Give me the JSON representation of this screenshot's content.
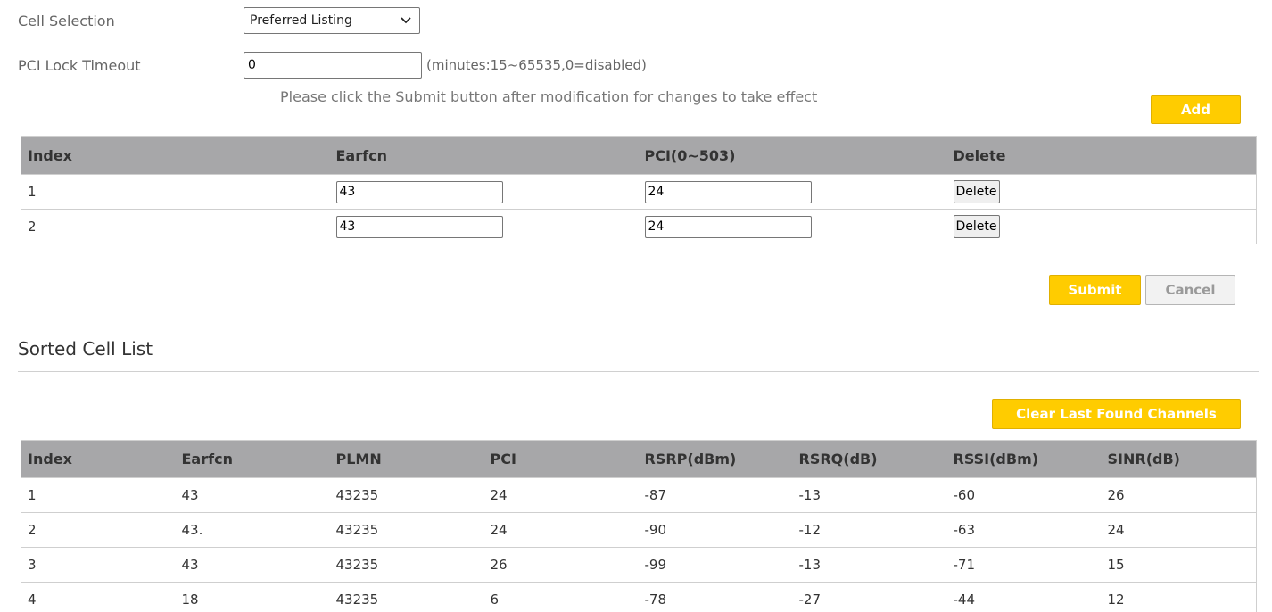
{
  "form": {
    "cell_selection_label": "Cell Selection",
    "cell_selection_value": "Preferred Listing",
    "pci_lock_timeout_label": "PCI Lock Timeout",
    "pci_lock_timeout_value": "0",
    "pci_lock_timeout_hint": "(minutes:15~65535,0=disabled)",
    "notice": "Please click the Submit button after modification for changes to take effect",
    "add_label": "Add"
  },
  "lock_table": {
    "headers": [
      "Index",
      "Earfcn",
      "PCI(0~503)",
      "Delete"
    ],
    "delete_label": "Delete",
    "rows": [
      {
        "index": "1",
        "earfcn": "43",
        "pci": "24"
      },
      {
        "index": "2",
        "earfcn": "43",
        "pci": "24"
      }
    ]
  },
  "actions": {
    "submit_label": "Submit",
    "cancel_label": "Cancel"
  },
  "sorted": {
    "title": "Sorted Cell List",
    "clear_label": "Clear Last Found Channels",
    "headers": [
      "Index",
      "Earfcn",
      "PLMN",
      "PCI",
      "RSRP(dBm)",
      "RSRQ(dB)",
      "RSSI(dBm)",
      "SINR(dB)"
    ],
    "rows": [
      [
        "1",
        "43",
        "43235",
        "24",
        "-87",
        "-13",
        "-60",
        "26"
      ],
      [
        "2",
        "43.",
        "43235",
        "24",
        "-90",
        "-12",
        "-63",
        "24"
      ],
      [
        "3",
        "43",
        "43235",
        "26",
        "-99",
        "-13",
        "-71",
        "15"
      ],
      [
        "4",
        "18",
        "43235",
        "6",
        "-78",
        "-27",
        "-44",
        "12"
      ]
    ]
  },
  "colors": {
    "accent": "#ffcc00",
    "table_header": "#a7a7a9"
  }
}
